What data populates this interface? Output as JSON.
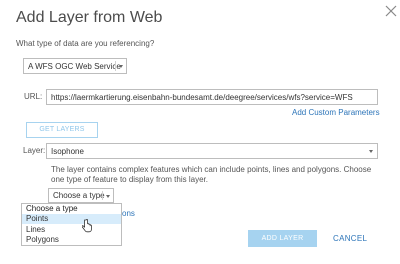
{
  "dialog": {
    "title": "Add Layer from Web",
    "question": "What type of data are you referencing?",
    "type_select": {
      "value": "A WFS OGC Web Service"
    },
    "url": {
      "label": "URL:",
      "value": "https://laermkartierung.eisenbahn-bundesamt.de/deegree/services/wfs?service=WFS"
    },
    "add_custom_parameters": "Add Custom Parameters",
    "get_layers_button": "GET LAYERS",
    "layer": {
      "label": "Layer:",
      "value": "Isophone"
    },
    "description": "The layer contains complex features which can include points, lines and polygons. Choose one type of feature to display from this layer.",
    "feature_type": {
      "selected": "Choose a type",
      "options": [
        "Choose a type",
        "Points",
        "Lines",
        "Polygons"
      ],
      "hovered": "Points"
    },
    "hidden_link_fragment": "ons",
    "add_layer_button": "ADD LAYER",
    "cancel_button": "CANCEL"
  },
  "colors": {
    "accent": "#2d75b9",
    "primary_disabled": "#a6d3f0",
    "hover_bg": "#d7ecfb"
  },
  "icons": {
    "close": "close-icon",
    "cursor": "hand-pointer-icon",
    "dropdown": "chevron-down-icon"
  }
}
